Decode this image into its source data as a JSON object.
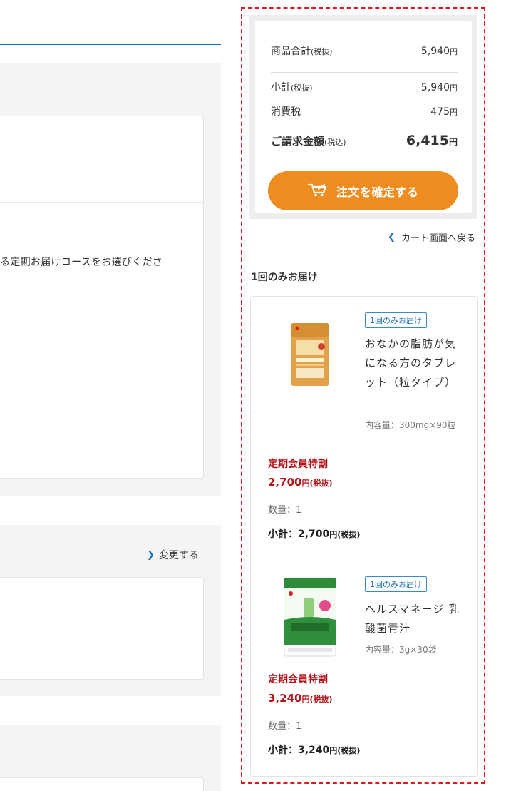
{
  "left": {
    "course_text": "る定期お届けコースをお選びくださ",
    "change_label": "変更する",
    "change_icon": "chevron-right-icon"
  },
  "summary": {
    "goods_total_label": "商品合計",
    "goods_total_note": "(税抜)",
    "goods_total_value": "5,940",
    "subtotal_label": "小計",
    "subtotal_note": "(税抜)",
    "subtotal_value": "5,940",
    "tax_label": "消費税",
    "tax_value": "475",
    "billing_label": "ご請求金額",
    "billing_note": "(税込)",
    "billing_value": "6,415",
    "yen": "円",
    "confirm_label": "注文を確定する",
    "confirm_icon": "cart-icon"
  },
  "back_link": {
    "label": "カート画面へ戻る",
    "icon": "chevron-left-icon"
  },
  "section": {
    "title": "1回のみお届け"
  },
  "items": [
    {
      "badge": "1回のみお届け",
      "name": "おなかの脂肪が気になる方のタブレット（粒タイプ）",
      "capacity": "内容量：300mg×90粒",
      "member_label": "定期会員特割",
      "price": "2,700",
      "price_unit": "円(税抜)",
      "qty": "数量：1",
      "subtotal_label": "小計：",
      "subtotal": "2,700",
      "subtotal_unit": "円(税抜)"
    },
    {
      "badge": "1回のみお届け",
      "name": "ヘルスマネージ 乳酸菌青汁",
      "capacity": "内容量：3g×30袋",
      "member_label": "定期会員特割",
      "price": "3,240",
      "price_unit": "円(税抜)",
      "qty": "数量：1",
      "subtotal_label": "小計：",
      "subtotal": "3,240",
      "subtotal_unit": "円(税抜)"
    }
  ],
  "colors": {
    "accent_blue": "#1e6fb0",
    "confirm_orange": "#ee8c1f",
    "price_red": "#b3131a",
    "highlight_dash": "#e0191e"
  }
}
